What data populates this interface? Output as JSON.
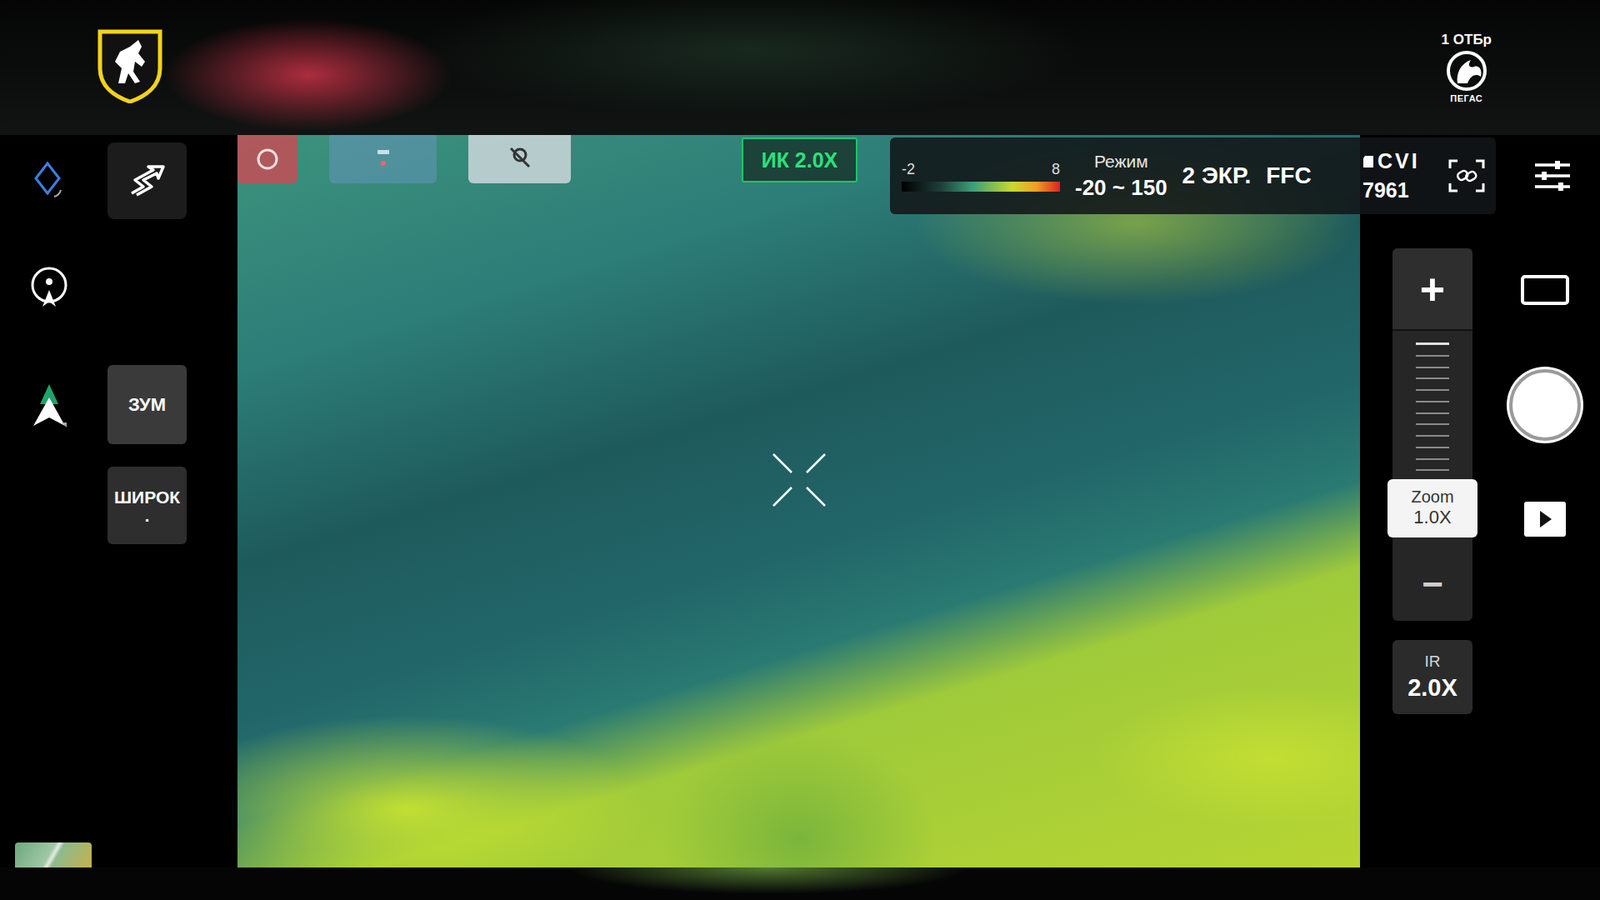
{
  "brand": {
    "unit": "1 ОТБр",
    "name": "ПЕГАС"
  },
  "camera_badge": "ИК 2.0X",
  "thermal_scale": {
    "min": "-2",
    "max": "8",
    "mode_label": "Режим",
    "range": "-20 ~ 150",
    "screens": "2 ЭКР.",
    "ffc": "FFC"
  },
  "storage": {
    "label": "CVI",
    "value": "7961"
  },
  "side_buttons": [
    {
      "label": "ЗУМ"
    },
    {
      "label": "ШИРОК",
      "mark": "."
    }
  ],
  "zoom_slider": {
    "plus": "+",
    "minus": "−",
    "label": "Zoom",
    "value": "1.0X",
    "level": 0.15
  },
  "ir_zoom": {
    "label": "IR",
    "value": "2.0X"
  }
}
